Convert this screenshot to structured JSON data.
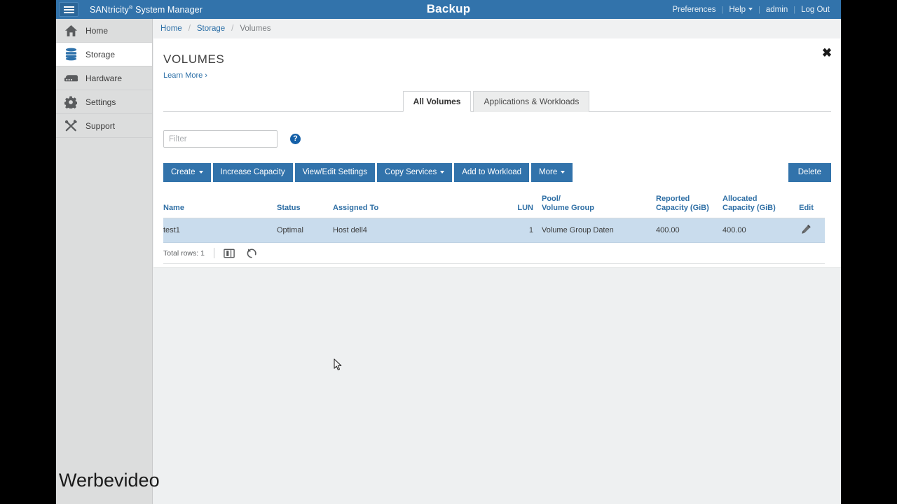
{
  "header": {
    "menu_icon": "hamburger-icon",
    "brand": "SANtricity",
    "brand_sup": "®",
    "brand_suffix": " System Manager",
    "system_name": "Backup",
    "preferences": "Preferences",
    "help": "Help",
    "user": "admin",
    "logout": "Log Out",
    "separator": "|",
    "bg_color": "#3273ab"
  },
  "sidebar": {
    "items": [
      {
        "label": "Home",
        "icon": "home-icon",
        "active": false
      },
      {
        "label": "Storage",
        "icon": "storage-disk-icon",
        "active": true
      },
      {
        "label": "Hardware",
        "icon": "hardware-tray-icon",
        "active": false
      },
      {
        "label": "Settings",
        "icon": "gear-icon",
        "active": false
      },
      {
        "label": "Support",
        "icon": "tools-wrench-hammer-icon",
        "active": false
      }
    ]
  },
  "breadcrumb": {
    "home": "Home",
    "storage": "Storage",
    "current": "Volumes",
    "separator": "/"
  },
  "panel": {
    "title": "VOLUMES",
    "learn_more": "Learn More ›",
    "close_icon": "close-x-icon"
  },
  "tabs": [
    {
      "label": "All Volumes",
      "active": true
    },
    {
      "label": "Applications & Workloads",
      "active": false
    }
  ],
  "filter": {
    "placeholder": "Filter",
    "value": "",
    "help_icon": "question-mark-icon",
    "help_glyph": "?"
  },
  "toolbar": {
    "create": "Create",
    "increase_capacity": "Increase Capacity",
    "view_edit_settings": "View/Edit Settings",
    "copy_services": "Copy Services",
    "add_to_workload": "Add to Workload",
    "more": "More",
    "delete": "Delete",
    "button_color": "#3273ab"
  },
  "table": {
    "columns": [
      {
        "label": "Name",
        "key": "name"
      },
      {
        "label": "Status",
        "key": "status"
      },
      {
        "label": "Assigned To",
        "key": "assigned_to"
      },
      {
        "label": "LUN",
        "key": "lun"
      },
      {
        "label": "Pool/",
        "label2": "Volume Group",
        "key": "pool"
      },
      {
        "label": "Reported",
        "label2": "Capacity (GiB)",
        "key": "reported"
      },
      {
        "label": "Allocated",
        "label2": "Capacity (GiB)",
        "key": "allocated"
      },
      {
        "label": "Edit",
        "key": "edit"
      }
    ],
    "header_labels": {
      "name": "Name",
      "status": "Status",
      "assigned_to": "Assigned To",
      "lun": "LUN",
      "pool_line1": "Pool/",
      "pool_line2": "Volume Group",
      "reported_line1": "Reported",
      "reported_line2": "Capacity (GiB)",
      "allocated_line1": "Allocated",
      "allocated_line2": "Capacity (GiB)",
      "edit": "Edit"
    },
    "rows": [
      {
        "name": "test1",
        "status": "Optimal",
        "assigned_to": "Host dell4",
        "lun": "1",
        "pool": "Volume Group Daten",
        "reported": "400.00",
        "allocated": "400.00",
        "edit_icon": "pencil-icon"
      }
    ],
    "row_highlight_color": "#c9dced",
    "footer": {
      "total_rows": "Total rows: 1",
      "columns_icon": "column-chooser-icon",
      "refresh_icon": "refresh-undo-icon"
    }
  },
  "overlay": {
    "watermark": "Werbevideo"
  }
}
